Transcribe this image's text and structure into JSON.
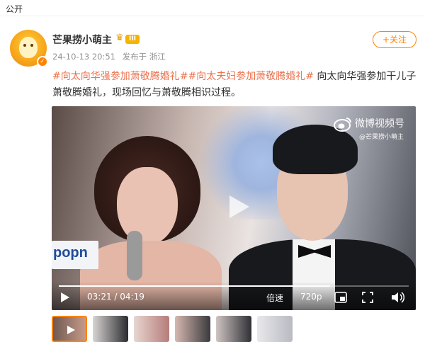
{
  "visibility": "公开",
  "post": {
    "username": "芒果捞小萌主",
    "level_badge": "III",
    "timestamp": "24-10-13 20:51",
    "source": "发布于 浙江",
    "follow_label": "+关注",
    "topic_1": "#向太向华强参加萧敬腾婚礼#",
    "topic_2": "#向太夫妇参加萧敬腾婚礼#",
    "body": " 向太向华强参加干儿子萧敬腾婚礼，现场回忆与萧敬腾相识过程。"
  },
  "video": {
    "watermark_name": "微博视频号",
    "watermark_user": "@芒果捞小萌主",
    "sign_text": "popn",
    "current_time": "03:21",
    "total_time": "04:19",
    "time_separator": " / ",
    "progress": 0.776,
    "speed_label": "倍速",
    "quality_label": "720p"
  },
  "thumbnails": [
    {
      "colors": [
        "#6e5a52",
        "#c79a8a"
      ]
    },
    {
      "colors": [
        "#d8d4d2",
        "#2b2c30"
      ]
    },
    {
      "colors": [
        "#e7d6d0",
        "#b67c7a"
      ]
    },
    {
      "colors": [
        "#d7b8b0",
        "#3a3a3e"
      ]
    },
    {
      "colors": [
        "#cfc5c2",
        "#2f3036"
      ]
    },
    {
      "colors": [
        "#e8e8ec",
        "#b9bac2"
      ]
    }
  ],
  "colors": {
    "accent": "#ff8200",
    "topic": "#eb7350",
    "meta": "#939393"
  },
  "icons": [
    "verified-icon",
    "crown-icon",
    "weibo-logo-icon",
    "play-icon",
    "pip-icon",
    "fullscreen-icon",
    "volume-icon"
  ]
}
